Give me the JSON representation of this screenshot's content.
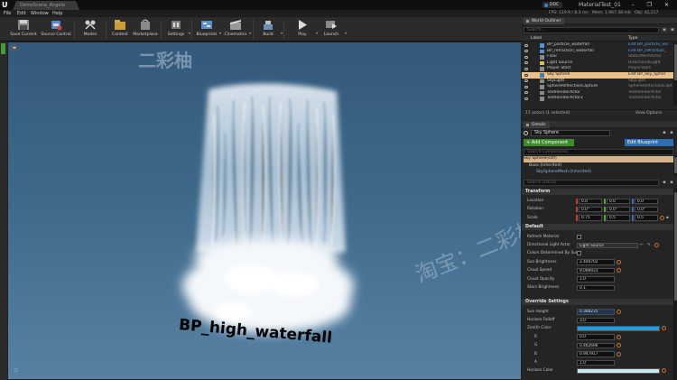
{
  "window": {
    "document_tab": "DemoScene_Angela",
    "source_control": "DDC",
    "project_name": "MaterialTest_01",
    "controls": "– ❐ ✕"
  },
  "menu": [
    "File",
    "Edit",
    "Window",
    "Help"
  ],
  "stats": {
    "fps": "FPS: 119.9 / 8.3 ms",
    "mem": "Mem: 1,967.38 mb",
    "obj": "Obj: 42,217"
  },
  "toolbar": [
    {
      "label": "Save Current",
      "icon": "save-icon"
    },
    {
      "label": "Source Control",
      "icon": "source-control-icon"
    },
    {
      "label": "Modes",
      "icon": "modes-icon"
    },
    {
      "label": "Content",
      "icon": "content-icon"
    },
    {
      "label": "Marketplace",
      "icon": "marketplace-icon"
    },
    {
      "label": "Settings",
      "icon": "settings-icon"
    },
    {
      "label": "Blueprints",
      "icon": "blueprints-icon"
    },
    {
      "label": "Cinematics",
      "icon": "cinematics-icon"
    },
    {
      "label": "Build",
      "icon": "build-icon"
    },
    {
      "label": "Play",
      "icon": "play-icon"
    },
    {
      "label": "Launch",
      "icon": "launch-icon"
    }
  ],
  "viewport": {
    "actor_label": "BP_high_waterfall",
    "watermark_logo": "二彩柚",
    "watermark_text": "淘宝：二彩柚素材"
  },
  "outliner": {
    "tab": "World Outliner",
    "search_placeholder": "Search...",
    "col_label": "Label",
    "col_type": "Type",
    "items": [
      {
        "label": "BP_particle_waterfall",
        "type": "Edit BP_particle_wa",
        "link": true
      },
      {
        "label": "BP_refraction_waterfall",
        "type": "Edit BP_refraction_",
        "link": true
      },
      {
        "label": "Floor",
        "type": "StaticMeshActor",
        "link": false
      },
      {
        "label": "Light Source",
        "type": "DirectionalLight",
        "link": false
      },
      {
        "label": "Player Start",
        "type": "PlayerStart",
        "link": false
      },
      {
        "label": "Sky Sphere",
        "type": "Edit BP_Sky_Spher",
        "link": true,
        "selected": true
      },
      {
        "label": "SkyLight",
        "type": "SkyLight",
        "link": false
      },
      {
        "label": "SphereReflectionCapture",
        "type": "SphereReflectionCapt",
        "link": false
      },
      {
        "label": "TextRenderActor",
        "type": "TextRenderActor",
        "link": false
      },
      {
        "label": "TextRenderActor2",
        "type": "TextRenderActor",
        "link": false
      }
    ],
    "footer": "17 actors (1 selected)",
    "view_options": "View Options"
  },
  "details": {
    "tab": "Details",
    "actor_name": "Sky Sphere",
    "add_component": "+ Add Component",
    "edit_blueprint": "Edit Blueprint",
    "search_components": "Search Components",
    "components": [
      "Sky Sphere(self)",
      "Base (Inherited)",
      "SkySphereMesh (Inherited)"
    ],
    "search_details": "Search Details",
    "transform": {
      "title": "Transform",
      "location": {
        "label": "Location",
        "x": "0.0",
        "y": "0.0",
        "z": "0.0"
      },
      "rotation": {
        "label": "Rotation",
        "x": "0.0°",
        "y": "0.0°",
        "z": "0.0°"
      },
      "scale": {
        "label": "Scale",
        "x": "0.75",
        "y": "0.5",
        "z": "0.5"
      }
    },
    "default": {
      "title": "Default",
      "refresh_material": "Refresh Material",
      "directional_light_actor": {
        "label": "Directional Light Actor",
        "value": "Light Source"
      },
      "colors_determined_by_sun": "Colors Determined By Sun",
      "sun_brightness": {
        "label": "Sun Brightness",
        "value": "2.440702"
      },
      "cloud_speed": {
        "label": "Cloud Speed",
        "value": "9.090931"
      },
      "cloud_opacity": {
        "label": "Cloud Opacity",
        "value": "1.0"
      },
      "stars_brightness": {
        "label": "Stars Brightness",
        "value": "0.1"
      }
    },
    "override": {
      "title": "Override Settings",
      "sun_height": {
        "label": "Sun Height",
        "value": "0.388235"
      },
      "horizon_falloff": {
        "label": "Horizon Falloff",
        "value": "3.0"
      },
      "zenith_color": {
        "label": "Zenith Color",
        "color": "#1e9fe0"
      },
      "r": {
        "label": "R",
        "value": "0.0"
      },
      "g": {
        "label": "G",
        "value": "0.462696"
      },
      "b": {
        "label": "B",
        "value": "0.947917"
      },
      "a": {
        "label": "A",
        "value": "1.0"
      },
      "horizon_color": {
        "label": "Horizon Color",
        "color": "#c9e8f4"
      }
    }
  },
  "colors": {
    "accent_selection": "#e8c28a",
    "add_component": "#3d8a2f",
    "edit_blueprint": "#2e6cb3",
    "viewport_sky": "#3e6889"
  }
}
